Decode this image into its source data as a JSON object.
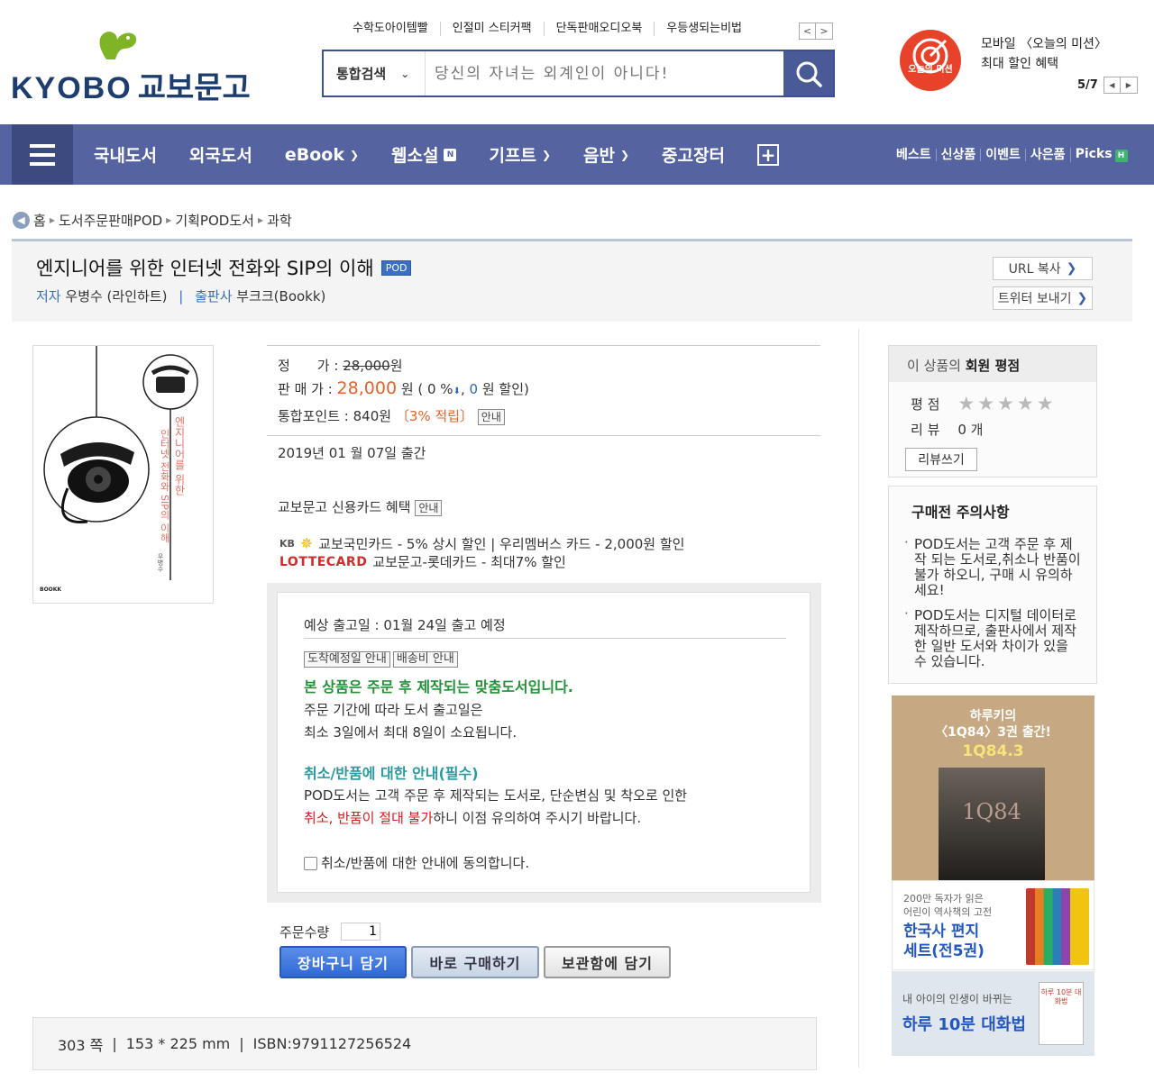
{
  "logo": {
    "text_en": "KYOBO",
    "text_kr": "교보문고"
  },
  "quicklinks": [
    "수학도아이템빨",
    "인절미 스티커팩",
    "단독판매오디오북",
    "우등생되는비법"
  ],
  "search": {
    "category": "통합검색",
    "placeholder": "당신의 자녀는 외계인이 아니다!"
  },
  "promo": {
    "badge": "오늘의 미션",
    "line1": "모바일 〈오늘의 미션〉",
    "line2": "최대 할인 혜택",
    "pager": "5/7"
  },
  "nav": {
    "items": [
      "국내도서",
      "외국도서",
      "eBook",
      "웹소설",
      "기프트",
      "음반",
      "중고장터"
    ],
    "right": [
      "베스트",
      "신상품",
      "이벤트",
      "사은품",
      "Picks"
    ],
    "badge_n": "N",
    "badge_h": "H"
  },
  "breadcrumb": [
    "홈",
    "도서주문판매POD",
    "기획POD도서",
    "과학"
  ],
  "book": {
    "title": "엔지니어를 위한 인터넷 전화와 SIP의 이해",
    "badge": "POD",
    "author_label": "저자",
    "author": "우병수 (라인하트)",
    "publisher_label": "출판사",
    "publisher": "부크크(Bookk)",
    "cover_title1": "엔지니어를 위한",
    "cover_title2": "인터넷 전화와 SIP의 이해",
    "cover_author": "우병수",
    "cover_brand": "BOOKK"
  },
  "actions": {
    "url_copy": "URL 복사",
    "twitter": "트위터 보내기"
  },
  "price": {
    "list_label": "정　　가 :",
    "list_price": "28,000",
    "won": "원",
    "sale_label": "판 매 가 :",
    "sale_price": "28,000",
    "sale_suffix_a": "원 ( 0 %",
    "sale_discount": "0",
    "sale_suffix_b": "원 할인)",
    "points_label": "통합포인트 :",
    "points": "840원",
    "points_rate": "〔3% 적립〕",
    "info_btn": "안내"
  },
  "pub_date": "2019년 01 월 07일 출간",
  "card": {
    "title": "교보문고 신용카드 혜택",
    "info_btn": "안내",
    "kb_logo": "KB",
    "line1": "교보국민카드 - 5% 상시 할인  |  우리멤버스 카드 - 2,000원 할인",
    "lotte_logo": "LOTTECARD",
    "line2": "교보문고-롯데카드 - 최대7% 할인"
  },
  "delivery": {
    "ship_date": "예상 출고일 : 01월 24일 출고 예정",
    "btn_arrival": "도착예정일 안내",
    "btn_fee": "배송비 안내",
    "notice_title": "본 상품은 주문 후 제작되는 맞춤도서입니다.",
    "notice_l1": "주문 기간에 따라 도서 출고일은",
    "notice_l2": "최소 3일에서 최대 8일이 소요됩니다.",
    "cancel_title": "취소/반품에 대한 안내(필수)",
    "cancel_l1": "POD도서는 고객 주문 후 제작되는 도서로, 단순변심 및 착오로 인한",
    "cancel_red": "취소, 반품이 절대 불가",
    "cancel_l2": "하니 이점 유의하여 주시기 바랍니다.",
    "agree": "취소/반품에 대한 안내에 동의합니다."
  },
  "order": {
    "qty_label": "주문수량",
    "qty": "1",
    "cart": "장바구니 담기",
    "buy": "바로 구매하기",
    "wish": "보관함에 담기"
  },
  "spec": {
    "pages": "303 쪽",
    "size": "153 * 225 mm",
    "isbn": "ISBN:9791127256524"
  },
  "rating": {
    "head_a": "이 상품의 ",
    "head_b": "회원 평점",
    "score_label": "평 점",
    "stars": 0,
    "review_label": "리 뷰",
    "review_count": "0 개",
    "review_btn": "리뷰쓰기"
  },
  "warnings": {
    "title": "구매전 주의사항",
    "items": [
      "POD도서는 고객 주문 후 제작 되는 도서로,취소나 반품이 불가 하오니, 구매 시 유의하세요!",
      "POD도서는 디지털 데이터로 제작하므로, 출판사에서 제작한 일반 도서와 차이가 있을 수 있습니다."
    ]
  },
  "ads": {
    "ad1_line1": "하루키의",
    "ad1_line2": "〈1Q84〉3권 출간!",
    "ad1_sub": "1Q84.3",
    "ad1_book": "1Q84",
    "ad2_small1": "200만 독자가 읽은",
    "ad2_small2": "어린이 역사책의 고전",
    "ad2_big1": "한국사 편지",
    "ad2_big2": "세트(전5권)",
    "ad3_small": "내 아이의 인생이 바뀌는",
    "ad3_big": "하루 10분 대화법",
    "ad3_book": "하루 10분 대화법"
  }
}
